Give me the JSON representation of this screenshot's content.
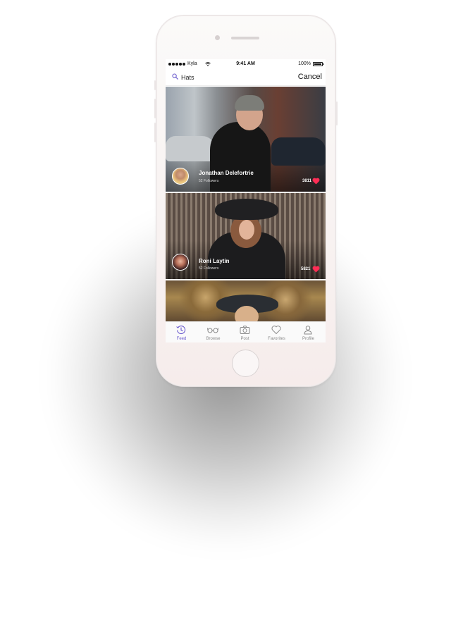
{
  "status_bar": {
    "carrier": "Kyla",
    "time": "9:41 AM",
    "battery": "100%"
  },
  "search": {
    "query": "Hats",
    "cancel_label": "Cancel",
    "icon": "search-icon"
  },
  "feed": {
    "posts": [
      {
        "name": "Jonathan Delefortrie",
        "followers": "52 Followers",
        "likes": "3811"
      },
      {
        "name": "Roni Laytin",
        "followers": "52 Followers",
        "likes": "5821"
      }
    ]
  },
  "tab_bar": {
    "tabs": [
      {
        "label": "Feed",
        "icon": "feed-icon",
        "active": true
      },
      {
        "label": "Browse",
        "icon": "glasses-icon",
        "active": false
      },
      {
        "label": "Post",
        "icon": "camera-icon",
        "active": false
      },
      {
        "label": "Favorites",
        "icon": "heart-icon",
        "active": false
      },
      {
        "label": "Profile",
        "icon": "profile-icon",
        "active": false
      }
    ]
  },
  "colors": {
    "accent": "#6a5acd",
    "like": "#ff2d55"
  }
}
